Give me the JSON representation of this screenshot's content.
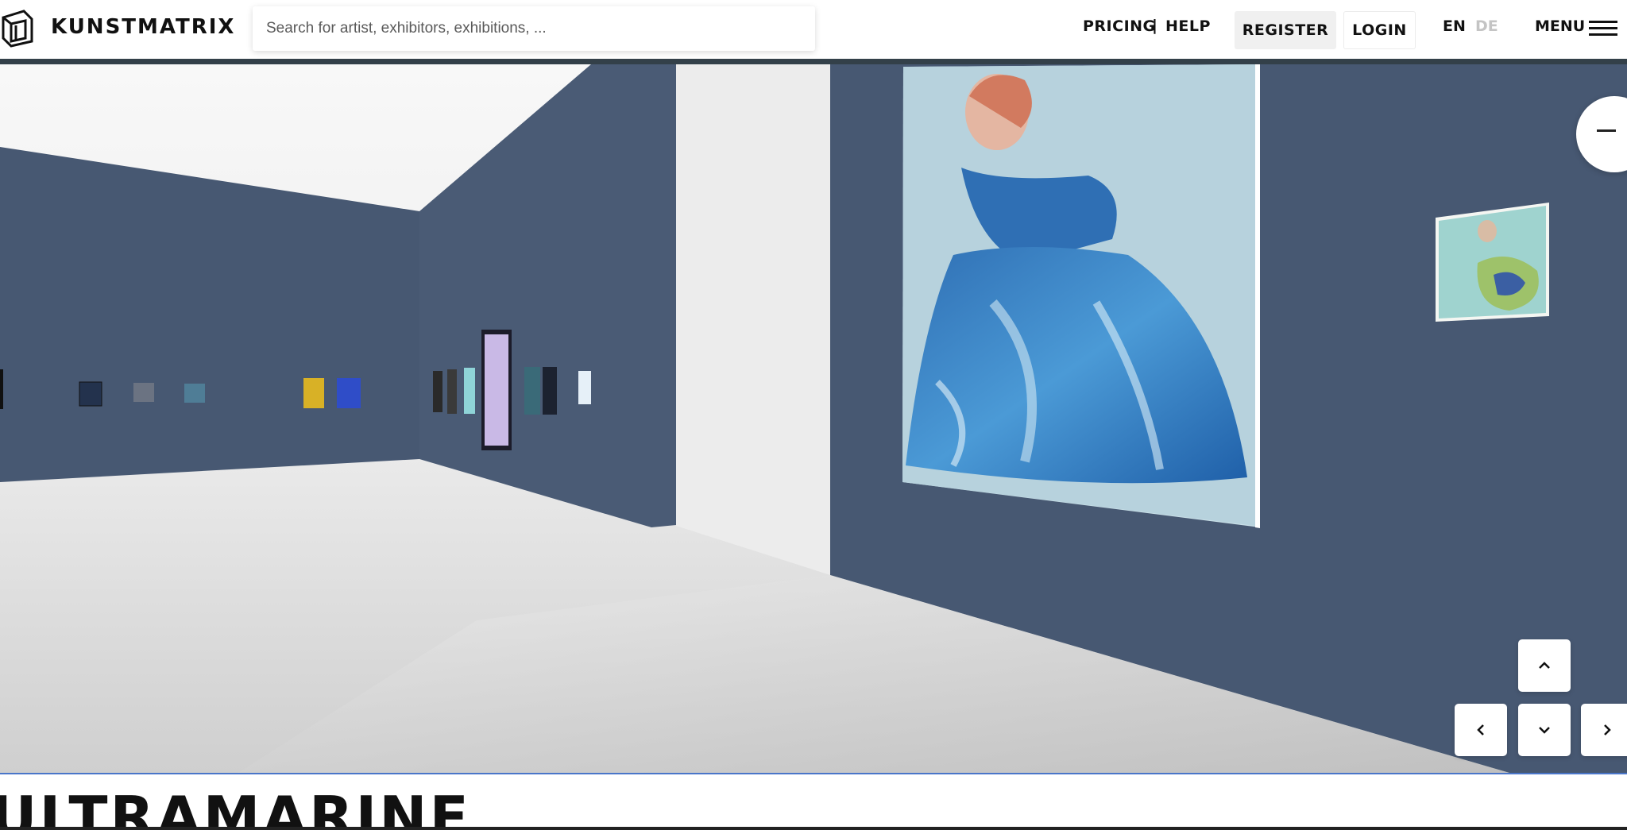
{
  "header": {
    "logo_text": "KUNSTMATRIX",
    "search_placeholder": "Search for artist, exhibitors, exhibitions, ...",
    "pricing_label": "PRICING",
    "separator": "|",
    "help_label": "HELP",
    "register_label": "REGISTER",
    "login_label": "LOGIN",
    "lang_en": "EN",
    "lang_de": "DE",
    "menu_label": "MENU"
  },
  "viewer": {
    "controls": {
      "up": "chevron-up-icon",
      "left": "chevron-left-icon",
      "down": "chevron-down-icon",
      "right": "chevron-right-icon"
    },
    "colors": {
      "wall": "#475872",
      "wall_dark": "#3e4e68",
      "ceiling": "#f4f4f4",
      "floor": "#e6e6e6"
    }
  },
  "exhibition": {
    "title": "ULTRAMARINE"
  }
}
